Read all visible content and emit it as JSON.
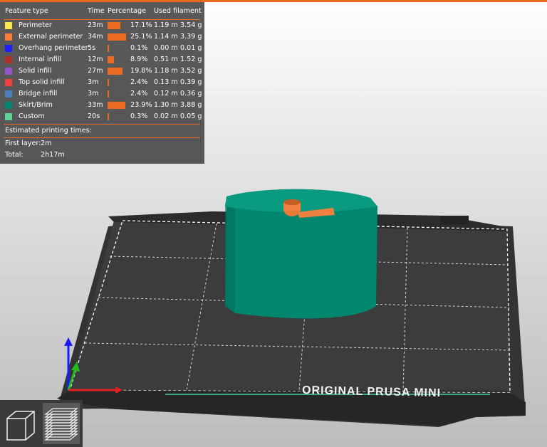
{
  "legend": {
    "header": {
      "feature_type": "Feature type",
      "time": "Time",
      "percentage": "Percentage",
      "used_filament": "Used filament"
    },
    "rows": [
      {
        "name": "Perimeter",
        "time": "23m",
        "pct_text": "17.1%",
        "pct": 17.1,
        "length": "1.19 m",
        "weight": "3.54 g",
        "color": "#ffe64d"
      },
      {
        "name": "External perimeter",
        "time": "34m",
        "pct_text": "25.1%",
        "pct": 25.1,
        "length": "1.14 m",
        "weight": "3.39 g",
        "color": "#ff7d38"
      },
      {
        "name": "Overhang perimeter",
        "time": "5s",
        "pct_text": "0.1%",
        "pct": 0.1,
        "length": "0.00 m",
        "weight": "0.01 g",
        "color": "#1f1fff"
      },
      {
        "name": "Internal infill",
        "time": "12m",
        "pct_text": "8.9%",
        "pct": 8.9,
        "length": "0.51 m",
        "weight": "1.52 g",
        "color": "#b03029"
      },
      {
        "name": "Solid infill",
        "time": "27m",
        "pct_text": "19.8%",
        "pct": 19.8,
        "length": "1.18 m",
        "weight": "3.52 g",
        "color": "#9654cc"
      },
      {
        "name": "Top solid infill",
        "time": "3m",
        "pct_text": "2.4%",
        "pct": 2.4,
        "length": "0.13 m",
        "weight": "0.39 g",
        "color": "#f04040"
      },
      {
        "name": "Bridge infill",
        "time": "3m",
        "pct_text": "2.4%",
        "pct": 2.4,
        "length": "0.12 m",
        "weight": "0.36 g",
        "color": "#4d80ba"
      },
      {
        "name": "Skirt/Brim",
        "time": "33m",
        "pct_text": "23.9%",
        "pct": 23.9,
        "length": "1.30 m",
        "weight": "3.88 g",
        "color": "#00876e"
      },
      {
        "name": "Custom",
        "time": "20s",
        "pct_text": "0.3%",
        "pct": 0.3,
        "length": "0.02 m",
        "weight": "0.05 g",
        "color": "#5ed194"
      }
    ],
    "estimated_label": "Estimated printing times:",
    "first_layer_label": "First layer:",
    "first_layer_value": "2m",
    "total_label": "Total:",
    "total_value": "2h17m"
  },
  "bed": {
    "logo_text": "ORIGINAL PRUSA MINI"
  },
  "colors": {
    "accent": "#ed6b21",
    "bed": "#3a3a3a",
    "model": "#00876e",
    "top_print": "#ff7d38"
  },
  "view_toolbar": {
    "icons": [
      "3d-view-icon",
      "preview-layers-icon"
    ]
  }
}
